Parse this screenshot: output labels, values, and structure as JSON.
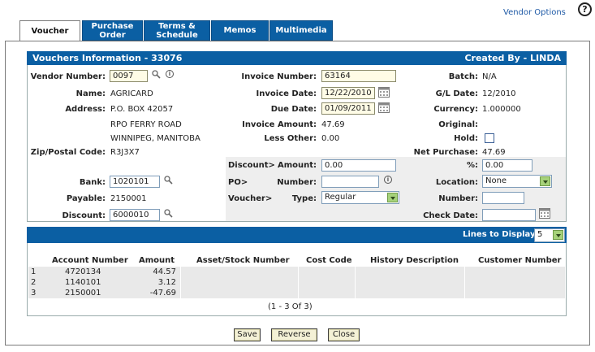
{
  "top": {
    "vendor_options": "Vendor Options",
    "help": "?"
  },
  "tabs": [
    {
      "label": "Voucher"
    },
    {
      "label": "Purchase Order"
    },
    {
      "label": "Terms & Schedule"
    },
    {
      "label": "Memos"
    },
    {
      "label": "Multimedia"
    }
  ],
  "header": {
    "title": "Vouchers Information  -  33076",
    "created_by": "Created By  -  LINDA"
  },
  "left": {
    "vendor_number_label": "Vendor Number:",
    "vendor_number": "0097",
    "name_label": "Name:",
    "name": "AGRICARD",
    "address_label": "Address:",
    "address1": "P.O. BOX 42057",
    "address2": "RPO FERRY ROAD",
    "address3": "WINNIPEG, MANITOBA",
    "zip_label": "Zip/Postal Code:",
    "zip": "R3J3X7",
    "bank_label": "Bank:",
    "bank": "1020101",
    "payable_label": "Payable:",
    "payable": "2150001",
    "discount_label": "Discount:",
    "discount": "6000010"
  },
  "middle": {
    "invoice_number_label": "Invoice Number:",
    "invoice_number": "63164",
    "invoice_date_label": "Invoice Date:",
    "invoice_date": "12/22/2010",
    "due_date_label": "Due Date:",
    "due_date": "01/09/2011",
    "invoice_amount_label": "Invoice Amount:",
    "invoice_amount": "47.69",
    "less_other_label": "Less Other:",
    "less_other": "0.00",
    "discount_group": "Discount>",
    "amount_label": "Amount:",
    "amount": "0.00",
    "po_group": "PO>",
    "number_label": "Number:",
    "po_number": "",
    "voucher_group": "Voucher>",
    "type_label": "Type:",
    "type": "Regular"
  },
  "right": {
    "batch_label": "Batch:",
    "batch": "N/A",
    "gl_date_label": "G/L Date:",
    "gl_date": "12/2010",
    "currency_label": "Currency:",
    "currency": "1.000000",
    "original_label": "Original:",
    "hold_label": "Hold:",
    "net_purchase_label": "Net Purchase:",
    "net_purchase": "47.69",
    "percent_label": "%:",
    "percent": "0.00",
    "location_label": "Location:",
    "location": "None",
    "number_label": "Number:",
    "number": "",
    "check_date_label": "Check Date:",
    "check_date": ""
  },
  "grid": {
    "lines_label": "Lines to Display:",
    "lines_value": "5",
    "columns": [
      "Account Number",
      "Amount",
      "Asset/Stock Number",
      "Cost Code",
      "History Description",
      "Customer Number"
    ],
    "rows": [
      {
        "n": "1",
        "account": "4720134",
        "amount": "44.57"
      },
      {
        "n": "2",
        "account": "1140101",
        "amount": "3.12"
      },
      {
        "n": "3",
        "account": "2150001",
        "amount": "-47.69"
      }
    ],
    "pager": "(1 - 3 Of 3)"
  },
  "buttons": {
    "save": "Save",
    "reverse": "Reverse",
    "close": "Close"
  }
}
